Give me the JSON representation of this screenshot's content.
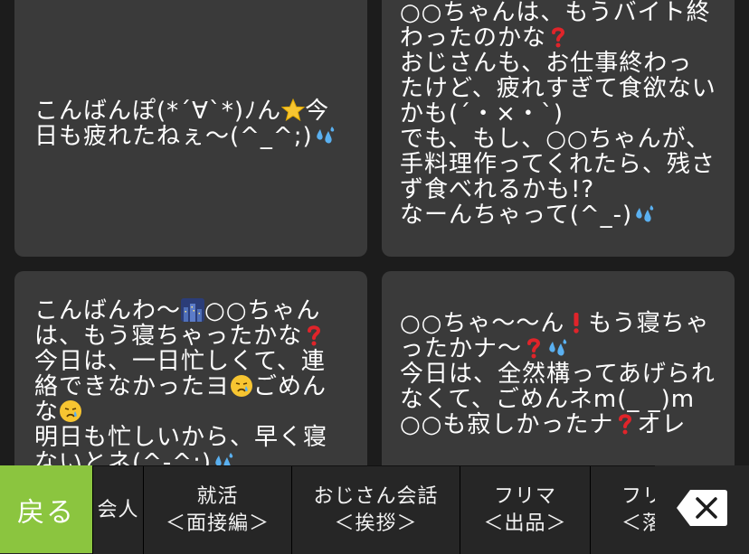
{
  "cards": [
    {
      "lines": [
        "こんばんぽ(*´∀`*)ﾉん",
        "今日も疲れたねぇ〜(^_^;)"
      ]
    },
    {
      "lines": [
        "○○ちゃんは、もうバイト終わったのかな",
        "おじさんも、お仕事終わったけど、疲れすぎて食欲ないかも(´・×・`)",
        "でも、もし、○○ちゃんが、手料理作ってくれたら、残さず食べれるかも!?",
        "なーんちゃって(^_-)"
      ]
    },
    {
      "lines": [
        "こんばんわ〜",
        "○○ちゃんは、もう寝ちゃったかな",
        "今日は、一日忙しくて、連絡できなかったヨ",
        "ごめんな",
        "明日も忙しいから、早く寝ないとネ(^-^;)"
      ]
    },
    {
      "lines": [
        "○○ちゃ〜〜ん",
        "もう寝ちゃったかナ〜",
        "今日は、全然構ってあげられなくて、ごめんネm(_ _)m",
        "○○も寂しかったナ",
        "オレ"
      ]
    }
  ],
  "bottom": {
    "back_label": "戻る",
    "categories": [
      {
        "line1": "会人",
        "line2": ""
      },
      {
        "line1": "就活",
        "line2": "＜面接編＞"
      },
      {
        "line1": "おじさん会話",
        "line2": "＜挨拶＞"
      },
      {
        "line1": "フリマ",
        "line2": "＜出品＞"
      },
      {
        "line1": "フリ",
        "line2": "＜落"
      }
    ],
    "delete_icon": "backspace-icon"
  },
  "icons": {
    "star": "star-emoji-icon",
    "sweat": "sweat-droplets-emoji-icon",
    "question": "red-question-mark-icon",
    "exclamation": "red-exclamation-mark-icon",
    "night": "night-city-emoji-icon",
    "crying": "crying-face-emoji-icon",
    "accent_green": "#8bc53f",
    "card_bg": "#3a3a3a"
  }
}
